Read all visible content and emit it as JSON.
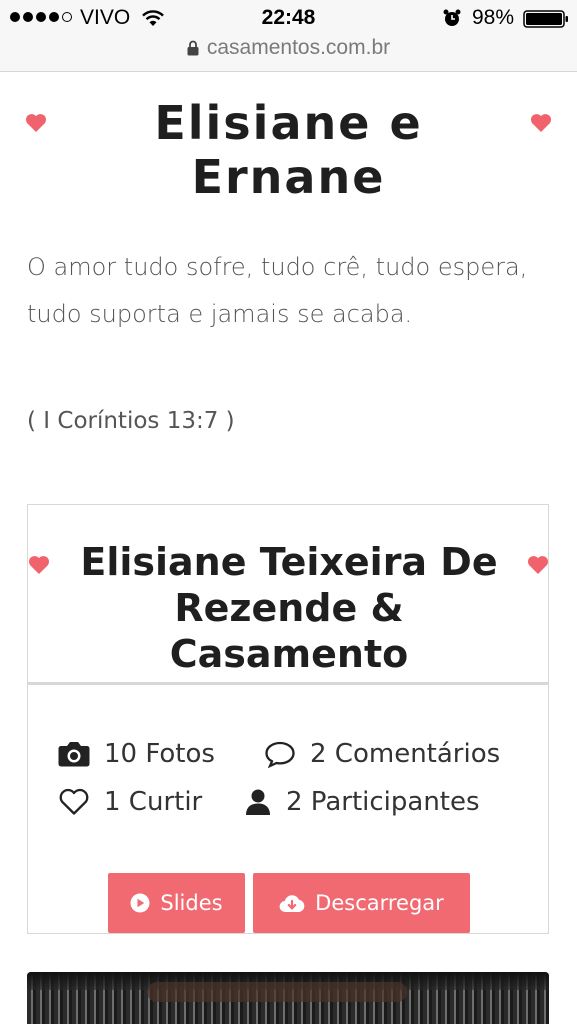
{
  "status_bar": {
    "carrier": "VIVO",
    "time": "22:48",
    "battery": "98%"
  },
  "browser": {
    "url": "casamentos.com.br"
  },
  "page": {
    "title": "Elisiane e Ernane",
    "quote": "O amor tudo sofre, tudo crê, tudo espera, tudo suporta e jamais se acaba.",
    "reference": "( I Coríntios 13:7 )"
  },
  "album": {
    "title": "Elisiane Teixeira De Rezende & Casamento",
    "photos": "10 Fotos",
    "comments": "2 Comentários",
    "likes": "1 Curtir",
    "participants": "2 Participantes",
    "slides_label": "Slides",
    "download_label": "Descarregar"
  },
  "colors": {
    "accent": "#f16a72",
    "heart": "#f0626c"
  }
}
